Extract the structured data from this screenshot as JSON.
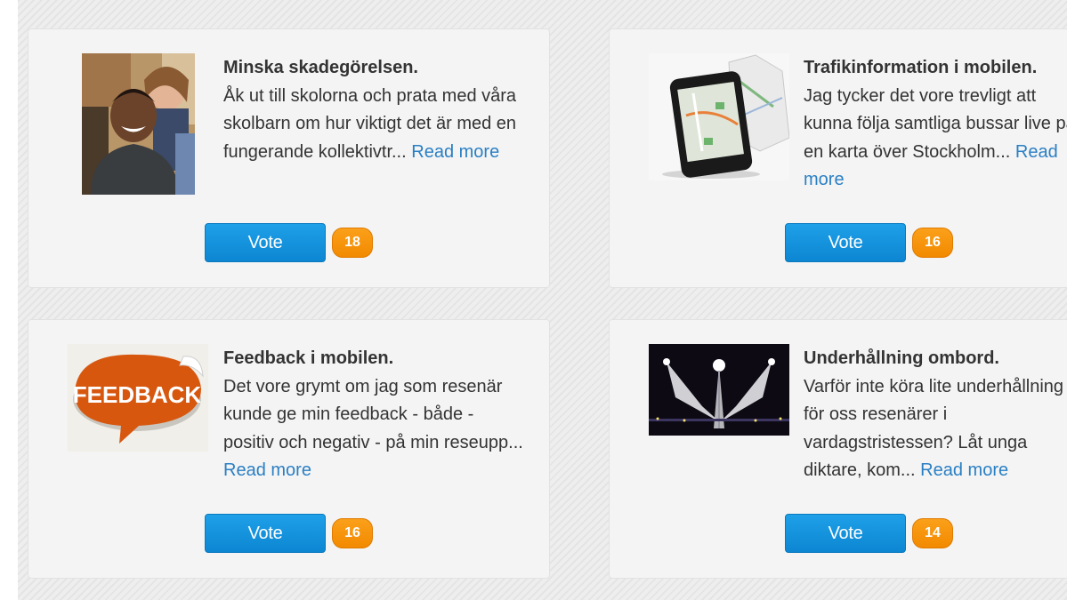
{
  "ideas": [
    {
      "title": "Minska skadegörelsen.",
      "body": "Åk ut till skolorna och prata med våra skolbarn om hur viktigt det är med en fungerande kollektivtr...",
      "read_more": "Read more",
      "vote_label": "Vote",
      "votes": "18",
      "image": "people-photo"
    },
    {
      "title": "Trafikinformation i mobilen.",
      "body": "Jag tycker det vore trevligt att kunna följa samtliga bussar live på en karta över Stockholm...",
      "read_more": "Read more",
      "vote_label": "Vote",
      "votes": "16",
      "image": "smartphone-map"
    },
    {
      "title": "Feedback i mobilen.",
      "body": "Det vore grymt om jag som resenär kunde ge min feedback - både - positiv och negativ - på min reseupp...",
      "read_more": "Read more",
      "vote_label": "Vote",
      "votes": "16",
      "image": "feedback-bubble",
      "image_text": "FEEDBACK"
    },
    {
      "title": "Underhållning ombord.",
      "body": "Varför inte köra lite underhållning för oss resenärer i vardagstristessen? Låt unga diktare, kom...",
      "read_more": "Read more",
      "vote_label": "Vote",
      "votes": "14",
      "image": "stage-spotlights"
    }
  ],
  "colors": {
    "vote_button": "#1595dd",
    "badge": "#f7930e",
    "link": "#2a7fc4"
  }
}
